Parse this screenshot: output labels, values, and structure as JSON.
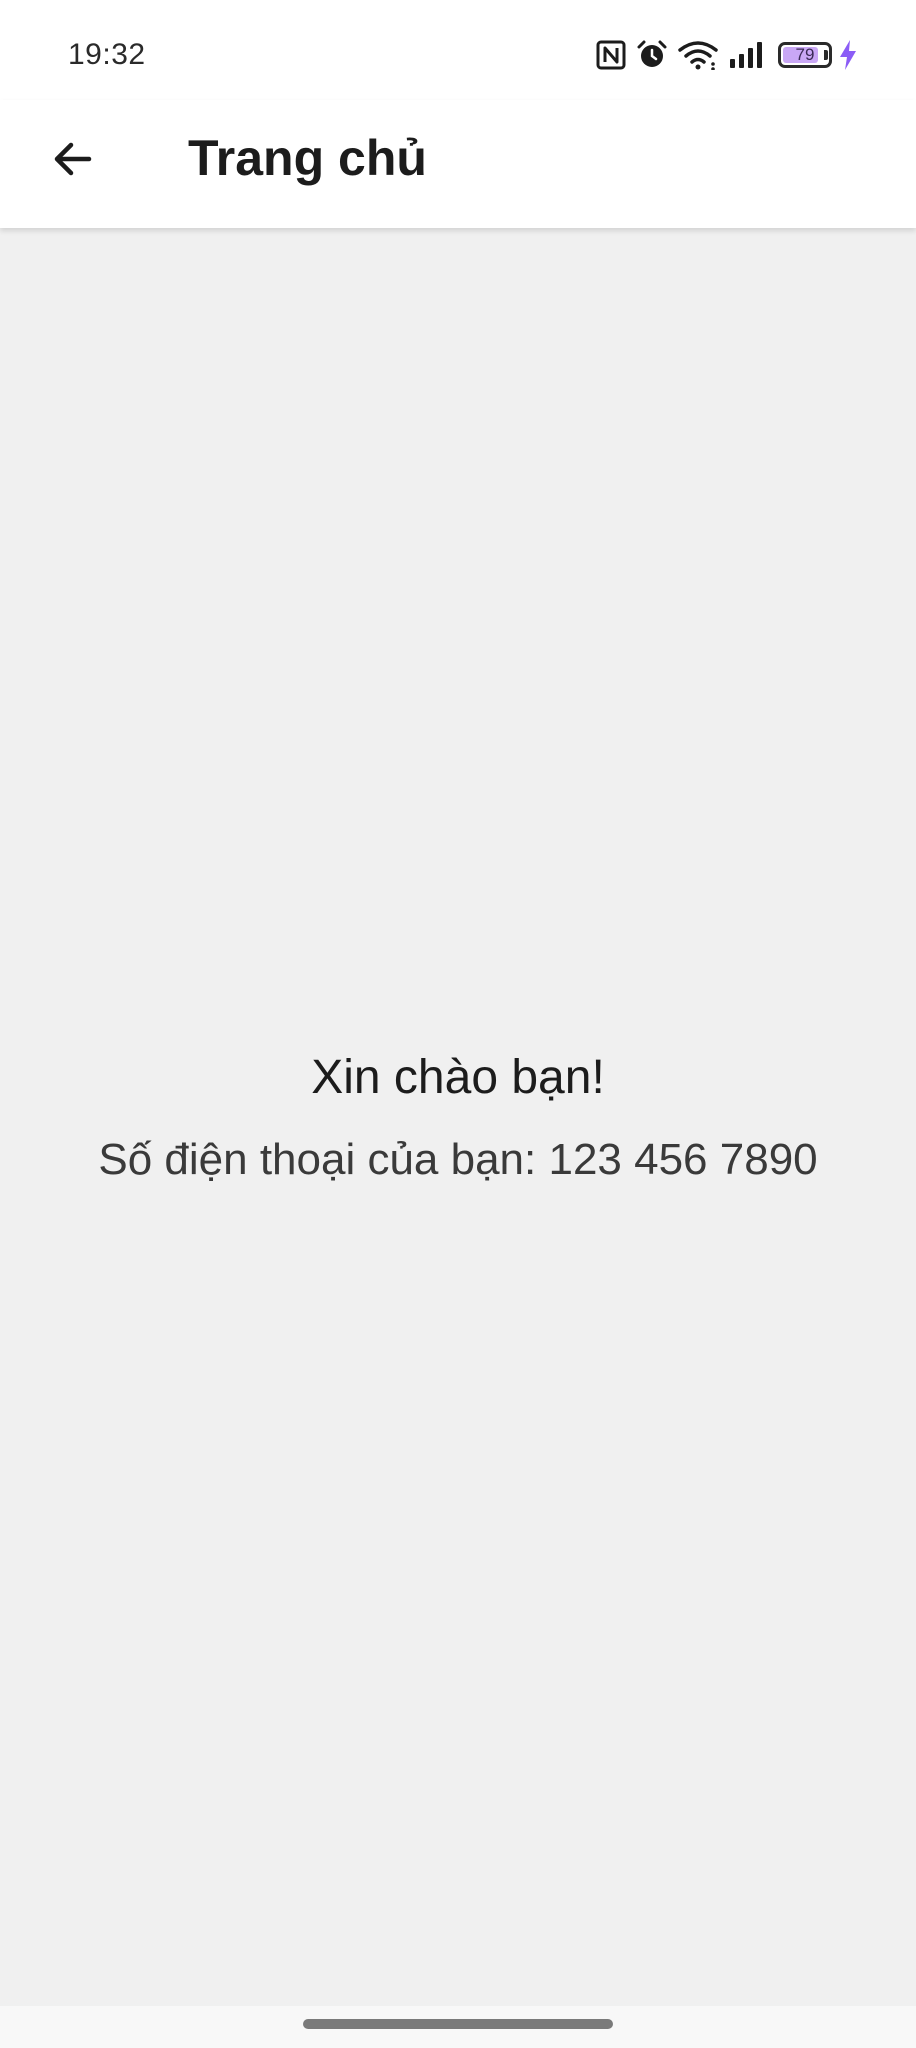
{
  "status_bar": {
    "time": "19:32",
    "icons": [
      "nfc-icon",
      "alarm-icon",
      "wifi-icon",
      "signal-icon",
      "battery-icon",
      "charging-icon"
    ],
    "battery_level": "79",
    "battery_percent": 79,
    "charging_color": "#8b5cf6"
  },
  "app_bar": {
    "back_icon": "arrow-left-icon",
    "title": "Trang chủ"
  },
  "main": {
    "greeting": "Xin chào bạn!",
    "phone_text": "Số điện thoại của bạn: 123 456 7890"
  },
  "colors": {
    "background": "#f0f0f0",
    "app_bar": "#ffffff",
    "text": "#1c1c1c"
  }
}
